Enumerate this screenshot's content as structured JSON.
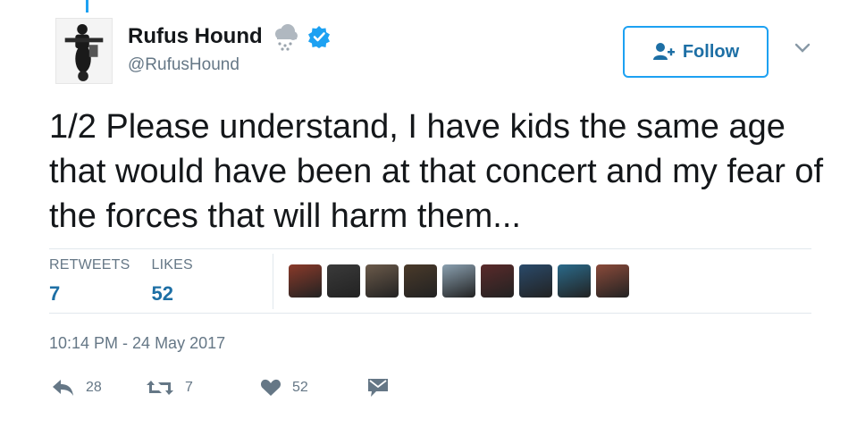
{
  "tweet": {
    "display_name": "Rufus Hound",
    "handle": "@RufusHound",
    "follow_label": "Follow",
    "text": "1/2 Please understand, I have kids the same age that would have been at that concert and my fear of the forces that will harm them...",
    "stats": {
      "retweets_label": "RETWEETS",
      "retweets_value": "7",
      "likes_label": "LIKES",
      "likes_value": "52"
    },
    "timestamp": "10:14 PM - 24 May 2017",
    "actions": {
      "reply_count": "28",
      "retweet_count": "7",
      "like_count": "52"
    }
  },
  "icons": [
    "cloud-snow-icon",
    "verified-icon",
    "follow-icon",
    "chevron-down-icon",
    "reply-icon",
    "retweet-icon",
    "heart-icon",
    "direct-message-icon"
  ],
  "liker_colors": [
    "#8a3a2a",
    "#3a3a3a",
    "#6b5a4a",
    "#4a3a2a",
    "#8aa0b0",
    "#5a2a2a",
    "#2a4a6a",
    "#2a6a8a",
    "#8a4a3a"
  ],
  "colors": {
    "accent": "#1da1f2",
    "link": "#1d6fa5",
    "muted": "#657786",
    "text": "#14171a"
  }
}
